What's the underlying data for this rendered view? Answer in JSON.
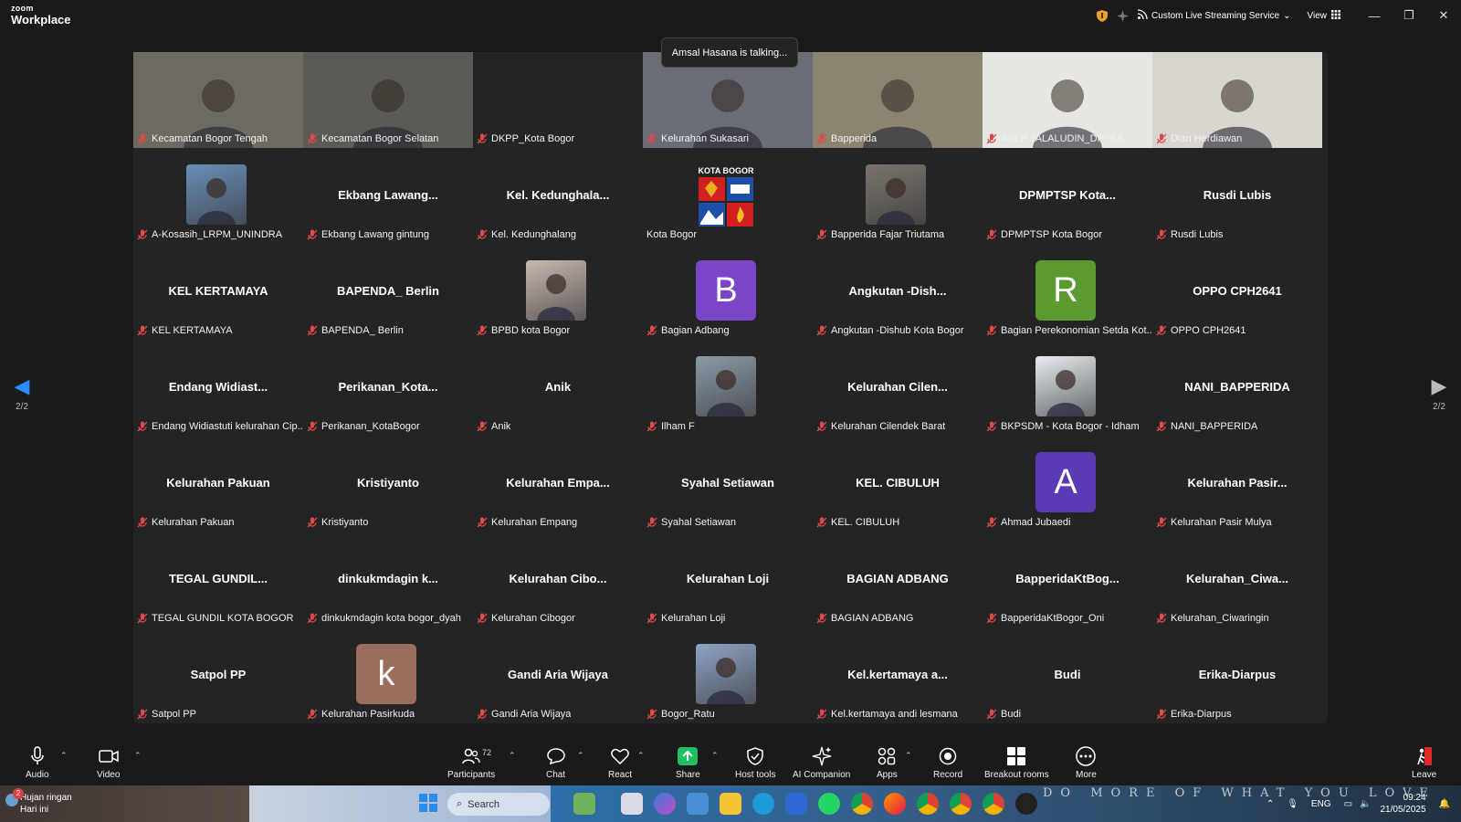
{
  "app": {
    "brand_small": "zoom",
    "brand_large": "Workplace"
  },
  "top": {
    "streaming_label": "Custom Live Streaming Service",
    "view_label": "View"
  },
  "toast": "Amsal Hasana is talking...",
  "pager": {
    "left": "2/2",
    "right": "2/2"
  },
  "tiles": [
    {
      "title": "",
      "name": "Kecamatan Bogor Tengah",
      "kind": "video",
      "bg": "#6d6a62"
    },
    {
      "title": "",
      "name": "Kecamatan Bogor Selatan",
      "kind": "video",
      "bg": "#5b5a55"
    },
    {
      "title": "",
      "name": "DKPP_Kota Bogor",
      "kind": "blank"
    },
    {
      "title": "",
      "name": "Kelurahan Sukasari",
      "kind": "video",
      "bg": "#6a6d75"
    },
    {
      "title": "",
      "name": "Bapperida",
      "kind": "video",
      "bg": "#8b8470"
    },
    {
      "title": "",
      "name": "ASEP JALALUDIN_DPPKB",
      "kind": "video",
      "bg": "#e8e6e2"
    },
    {
      "title": "",
      "name": "Dian Herdiawan",
      "kind": "video",
      "bg": "#d9d5cf"
    },
    {
      "title": "",
      "name": "A-Kosasih_LRPM_UNINDRA",
      "kind": "photo",
      "bg": "#6a8fb8"
    },
    {
      "title": "Ekbang  Lawang...",
      "name": "Ekbang Lawang gintung",
      "kind": "text"
    },
    {
      "title": "Kel.  Kedunghala...",
      "name": "Kel. Kedunghalang",
      "kind": "text"
    },
    {
      "title": "KOTA BOGOR",
      "name": "Kota Bogor",
      "kind": "logo"
    },
    {
      "title": "",
      "name": "Bapperida Fajar Triutama",
      "kind": "photo",
      "bg": "#7a746c"
    },
    {
      "title": "DPMPTSP  Kota...",
      "name": "DPMPTSP Kota Bogor",
      "kind": "text"
    },
    {
      "title": "Rusdi Lubis",
      "name": "Rusdi Lubis",
      "kind": "text"
    },
    {
      "title": "KEL KERTAMAYA",
      "name": "KEL KERTAMAYA",
      "kind": "text"
    },
    {
      "title": "BAPENDA_ Berlin",
      "name": "BAPENDA_ Berlin",
      "kind": "text"
    },
    {
      "title": "",
      "name": "BPBD kota Bogor",
      "kind": "photo",
      "bg": "#c8b8b0"
    },
    {
      "title": "B",
      "name": "Bagian Adbang",
      "kind": "avatar",
      "bg": "#7a45c7"
    },
    {
      "title": "Angkutan  -Dish...",
      "name": "Angkutan -Dishub Kota Bogor",
      "kind": "text"
    },
    {
      "title": "R",
      "name": "Bagian Perekonomian Setda Kot...",
      "kind": "avatar",
      "bg": "#5a9a30"
    },
    {
      "title": "OPPO CPH2641",
      "name": "OPPO CPH2641",
      "kind": "text"
    },
    {
      "title": "Endang  Widiast...",
      "name": "Endang Widiastuti kelurahan Cip...",
      "kind": "text"
    },
    {
      "title": "Perikanan_Kota...",
      "name": "Perikanan_KotaBogor",
      "kind": "text"
    },
    {
      "title": "Anik",
      "name": "Anik",
      "kind": "text"
    },
    {
      "title": "",
      "name": "Ilham F",
      "kind": "photo",
      "bg": "#8a9aa8"
    },
    {
      "title": "Kelurahan  Cilen...",
      "name": "Kelurahan Cilendek Barat",
      "kind": "text"
    },
    {
      "title": "",
      "name": "BKPSDM - Kota Bogor - Idham",
      "kind": "photo",
      "bg": "#e6ecf2"
    },
    {
      "title": "NANI_BAPPERIDA",
      "name": "NANI_BAPPERIDA",
      "kind": "text"
    },
    {
      "title": "Kelurahan Pakuan",
      "name": "Kelurahan Pakuan",
      "kind": "text"
    },
    {
      "title": "Kristiyanto",
      "name": "Kristiyanto",
      "kind": "text"
    },
    {
      "title": "Kelurahan  Empa...",
      "name": "Kelurahan Empang",
      "kind": "text"
    },
    {
      "title": "Syahal Setiawan",
      "name": "Syahal Setiawan",
      "kind": "text"
    },
    {
      "title": "KEL. CIBULUH",
      "name": "KEL. CIBULUH",
      "kind": "text"
    },
    {
      "title": "A",
      "name": "Ahmad Jubaedi",
      "kind": "avatar",
      "bg": "#5b3bb5"
    },
    {
      "title": "Kelurahan  Pasir...",
      "name": "Kelurahan Pasir Mulya",
      "kind": "text"
    },
    {
      "title": "TEGAL GUNDIL...",
      "name": "TEGAL GUNDIL KOTA BOGOR",
      "kind": "text"
    },
    {
      "title": "dinkukmdagin  k...",
      "name": "dinkukmdagin kota bogor_dyah",
      "kind": "text"
    },
    {
      "title": "Kelurahan  Cibo...",
      "name": "Kelurahan Cibogor",
      "kind": "text"
    },
    {
      "title": "Kelurahan Loji",
      "name": "Kelurahan Loji",
      "kind": "text"
    },
    {
      "title": "BAGIAN ADBANG",
      "name": "BAGIAN ADBANG",
      "kind": "text"
    },
    {
      "title": "BapperidaKtBog...",
      "name": "BapperidaKtBogor_Oni",
      "kind": "text"
    },
    {
      "title": "Kelurahan_Ciwa...",
      "name": "Kelurahan_Ciwaringin",
      "kind": "text"
    },
    {
      "title": "Satpol PP",
      "name": "Satpol PP",
      "kind": "text"
    },
    {
      "title": "k",
      "name": "Kelurahan Pasirkuda",
      "kind": "avatar",
      "bg": "#9a6e5e"
    },
    {
      "title": "Gandi Aria Wijaya",
      "name": "Gandi Aria Wijaya",
      "kind": "text"
    },
    {
      "title": "",
      "name": "Bogor_Ratu",
      "kind": "photo",
      "bg": "#8fa3c4"
    },
    {
      "title": "Kel.kertamaya  a...",
      "name": "Kel.kertamaya andi lesmana",
      "kind": "text"
    },
    {
      "title": "Budi",
      "name": "Budi",
      "kind": "text"
    },
    {
      "title": "Erika-Diarpus",
      "name": "Erika-Diarpus",
      "kind": "text"
    }
  ],
  "toolbar": {
    "audio": "Audio",
    "video": "Video",
    "participants": "Participants",
    "participants_count": "72",
    "chat": "Chat",
    "react": "React",
    "share": "Share",
    "host_tools": "Host tools",
    "ai_companion": "AI Companion",
    "apps": "Apps",
    "record": "Record",
    "breakout_rooms": "Breakout rooms",
    "more": "More",
    "leave": "Leave"
  },
  "taskbar": {
    "weather_title": "Hujan ringan",
    "weather_sub": "Hari ini",
    "weather_badge": "2",
    "search_placeholder": "Search",
    "motto": "DO MORE OF WHAT YOU LOVE",
    "lang": "ENG",
    "time": "09:24",
    "date": "21/05/2025"
  },
  "colors": {
    "accent": "#2d8cff",
    "mic_muted": "#e04a4a",
    "share_green": "#20c060",
    "leave_red": "#e02828"
  }
}
